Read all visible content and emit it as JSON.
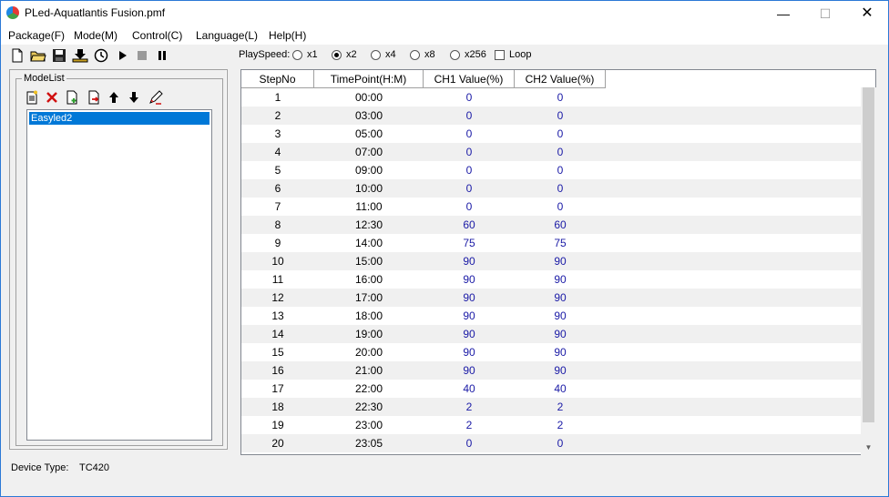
{
  "window": {
    "title": "PLed-Aquatlantis Fusion.pmf",
    "min_glyph": "—",
    "max_glyph": "☐",
    "close_glyph": "✕"
  },
  "menu": {
    "items": [
      {
        "label": "Package(F)"
      },
      {
        "label": "Mode(M)"
      },
      {
        "label": "Control(C)"
      },
      {
        "label": "Language(L)"
      },
      {
        "label": "Help(H)"
      }
    ]
  },
  "toolbar": {
    "icons": [
      "new-file-icon",
      "open-folder-icon",
      "save-icon",
      "download-icon",
      "clock-icon",
      "play-icon",
      "stop-icon",
      "pause-icon"
    ],
    "playspeed_label": "PlaySpeed:",
    "speeds": [
      {
        "label": "x1",
        "checked": false
      },
      {
        "label": "x2",
        "checked": true
      },
      {
        "label": "x4",
        "checked": false
      },
      {
        "label": "x8",
        "checked": false
      },
      {
        "label": "x256",
        "checked": false
      }
    ],
    "loop_label": "Loop",
    "loop_checked": false
  },
  "modelist": {
    "title": "ModeList",
    "tools": [
      "new-mode-icon",
      "delete-icon",
      "add-icon",
      "export-icon",
      "move-up-icon",
      "move-down-icon",
      "edit-icon"
    ],
    "items": [
      "Easyled2"
    ],
    "selected_index": 0
  },
  "grid": {
    "columns": [
      "StepNo",
      "TimePoint(H:M)",
      "CH1 Value(%)",
      "CH2 Value(%)"
    ],
    "rows": [
      [
        "1",
        "00:00",
        "0",
        "0"
      ],
      [
        "2",
        "03:00",
        "0",
        "0"
      ],
      [
        "3",
        "05:00",
        "0",
        "0"
      ],
      [
        "4",
        "07:00",
        "0",
        "0"
      ],
      [
        "5",
        "09:00",
        "0",
        "0"
      ],
      [
        "6",
        "10:00",
        "0",
        "0"
      ],
      [
        "7",
        "11:00",
        "0",
        "0"
      ],
      [
        "8",
        "12:30",
        "60",
        "60"
      ],
      [
        "9",
        "14:00",
        "75",
        "75"
      ],
      [
        "10",
        "15:00",
        "90",
        "90"
      ],
      [
        "11",
        "16:00",
        "90",
        "90"
      ],
      [
        "12",
        "17:00",
        "90",
        "90"
      ],
      [
        "13",
        "18:00",
        "90",
        "90"
      ],
      [
        "14",
        "19:00",
        "90",
        "90"
      ],
      [
        "15",
        "20:00",
        "90",
        "90"
      ],
      [
        "16",
        "21:00",
        "90",
        "90"
      ],
      [
        "17",
        "22:00",
        "40",
        "40"
      ],
      [
        "18",
        "22:30",
        "2",
        "2"
      ],
      [
        "19",
        "23:00",
        "2",
        "2"
      ],
      [
        "20",
        "23:05",
        "0",
        "0"
      ]
    ]
  },
  "status": {
    "device_type_label": "Device Type:",
    "device_type_value": "TC420"
  },
  "colors": {
    "selection": "#0078d7",
    "value_text": "#1a1aa6",
    "alt_row": "#f0f0f0"
  }
}
